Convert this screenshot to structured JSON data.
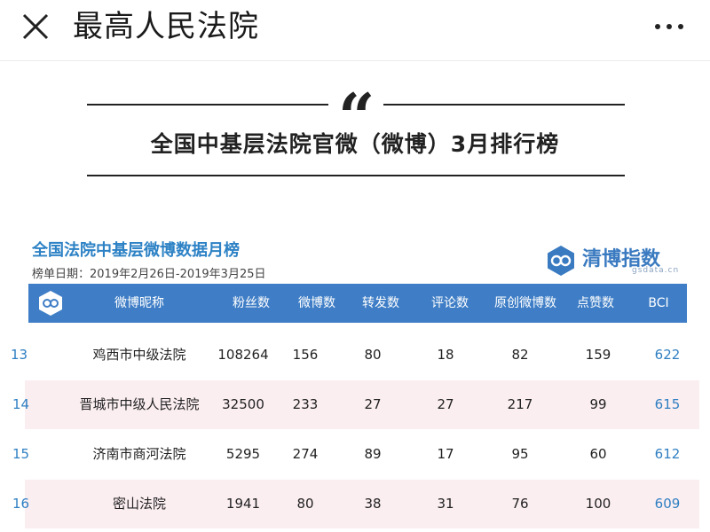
{
  "header": {
    "title": "最高人民法院",
    "close_icon": "close-icon",
    "more_icon": "more-horizontal-icon"
  },
  "article": {
    "quote_mark": "“",
    "headline": "全国中基层法院官微（微博）3月排行榜"
  },
  "ranking": {
    "title": "全国法院中基层微博数据月榜",
    "date_range": "榜单日期：2019年2月26日-2019年3月25日",
    "brand_name": "清博指数",
    "brand_sub": "gsdata.cn",
    "brand_color": "#3a7ac0",
    "header_color": "#3f7ec6",
    "columns": [
      "微博昵称",
      "粉丝数",
      "微博数",
      "转发数",
      "评论数",
      "原创微博数",
      "点赞数",
      "BCI"
    ],
    "rows": [
      {
        "rank": "13",
        "name": "鸡西市中级法院",
        "fans": "108264",
        "posts": "156",
        "reposts": "80",
        "comments": "18",
        "original": "82",
        "likes": "159",
        "bci": "622"
      },
      {
        "rank": "14",
        "name": "晋城市中级人民法院",
        "fans": "32500",
        "posts": "233",
        "reposts": "27",
        "comments": "27",
        "original": "217",
        "likes": "99",
        "bci": "615"
      },
      {
        "rank": "15",
        "name": "济南市商河法院",
        "fans": "5295",
        "posts": "274",
        "reposts": "89",
        "comments": "17",
        "original": "95",
        "likes": "60",
        "bci": "612"
      },
      {
        "rank": "16",
        "name": "密山法院",
        "fans": "1941",
        "posts": "80",
        "reposts": "38",
        "comments": "31",
        "original": "76",
        "likes": "100",
        "bci": "609"
      }
    ]
  }
}
